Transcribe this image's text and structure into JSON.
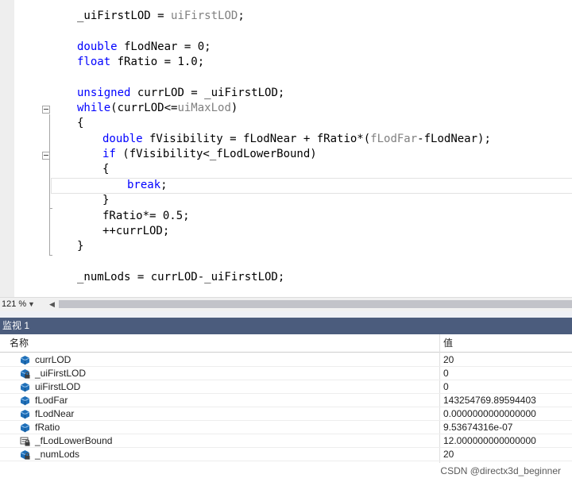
{
  "editor": {
    "lines": [
      [
        {
          "t": "_uiFirstLOD = ",
          "c": ""
        },
        {
          "t": "uiFirstLOD",
          "c": "id"
        },
        {
          "t": ";",
          "c": ""
        }
      ],
      [
        {
          "t": "double",
          "c": "kw"
        },
        {
          "t": " fLodNear = 0;",
          "c": ""
        }
      ],
      [
        {
          "t": "float",
          "c": "kw"
        },
        {
          "t": " fRatio = 1.0;",
          "c": ""
        }
      ],
      [
        {
          "t": "unsigned",
          "c": "kw"
        },
        {
          "t": " currLOD = _uiFirstLOD;",
          "c": ""
        }
      ],
      [
        {
          "t": "while",
          "c": "kw"
        },
        {
          "t": "(currLOD<=",
          "c": ""
        },
        {
          "t": "uiMaxLod",
          "c": "id"
        },
        {
          "t": ")",
          "c": ""
        }
      ],
      [
        {
          "t": "{",
          "c": ""
        }
      ],
      [
        {
          "t": "double",
          "c": "kw"
        },
        {
          "t": " fVisibility = fLodNear + fRatio*(",
          "c": ""
        },
        {
          "t": "fLodFar",
          "c": "id"
        },
        {
          "t": "-fLodNear);",
          "c": ""
        }
      ],
      [
        {
          "t": "if",
          "c": "kw"
        },
        {
          "t": " (fVisibility<_fLodLowerBound)",
          "c": ""
        }
      ],
      [
        {
          "t": "{",
          "c": ""
        }
      ],
      [
        {
          "t": "break",
          "c": "kw"
        },
        {
          "t": ";",
          "c": ""
        }
      ],
      [
        {
          "t": "}",
          "c": ""
        }
      ],
      [
        {
          "t": "fRatio*= 0.5;",
          "c": ""
        }
      ],
      [
        {
          "t": "++currLOD;",
          "c": ""
        }
      ],
      [
        {
          "t": "}",
          "c": ""
        }
      ],
      [
        {
          "t": "_numLods = currLOD-_uiFirstLOD;",
          "c": ""
        }
      ]
    ]
  },
  "zoom": {
    "value": "121 %"
  },
  "watch": {
    "title": "监视 1",
    "header_name": "名称",
    "header_value": "值",
    "rows": [
      {
        "name": "currLOD",
        "value": "20",
        "icon": "variable-icon"
      },
      {
        "name": "_uiFirstLOD",
        "value": "0",
        "icon": "locked-variable-icon"
      },
      {
        "name": "uiFirstLOD",
        "value": "0",
        "icon": "variable-icon"
      },
      {
        "name": "fLodFar",
        "value": "143254769.89594403",
        "icon": "variable-icon"
      },
      {
        "name": "fLodNear",
        "value": "0.0000000000000000",
        "icon": "variable-icon"
      },
      {
        "name": "fRatio",
        "value": "9.53674316e-07",
        "icon": "variable-icon"
      },
      {
        "name": "_fLodLowerBound",
        "value": "12.000000000000000",
        "icon": "locked-field-icon"
      },
      {
        "name": "_numLods",
        "value": "20",
        "icon": "locked-variable-icon"
      }
    ]
  },
  "watermark": "CSDN @directx3d_beginner"
}
